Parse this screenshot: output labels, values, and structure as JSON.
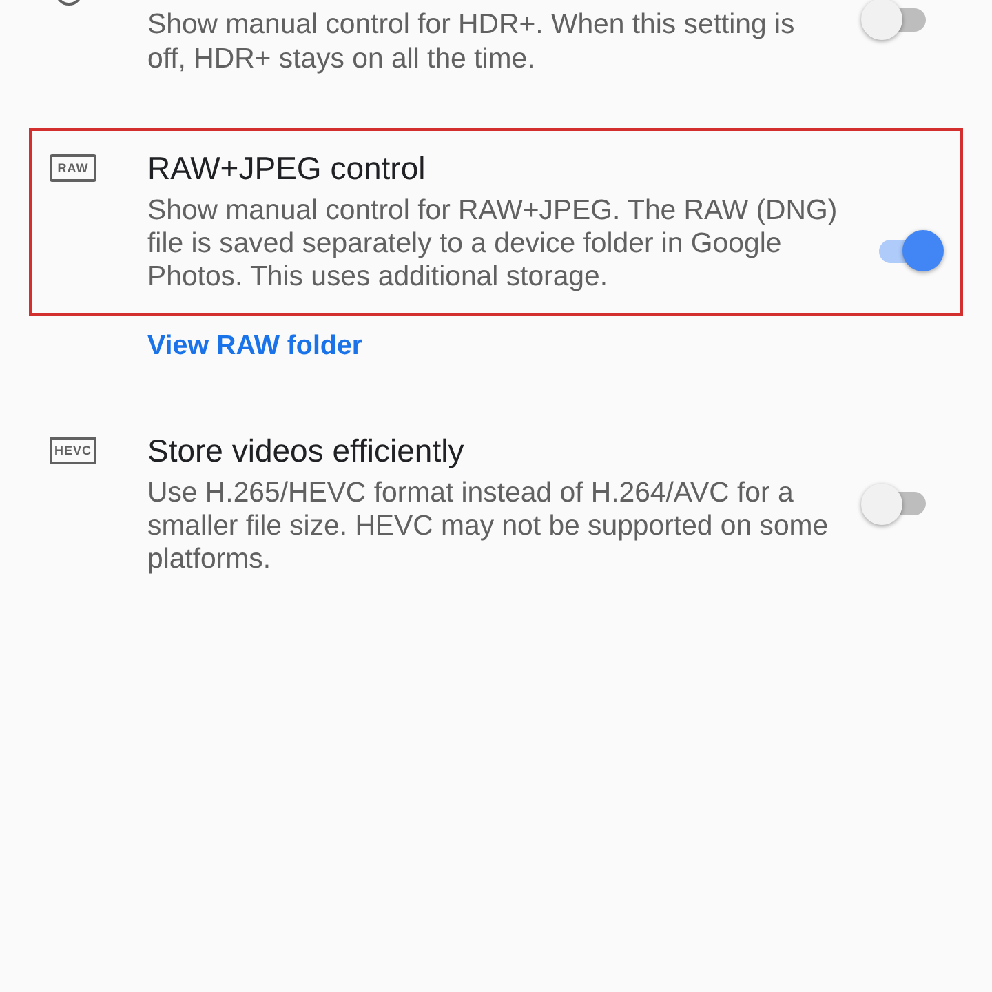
{
  "settings": [
    {
      "icon": {
        "kind": "circle"
      },
      "description": "Show manual control for HDR+. When this setting is off, HDR+ stays on all the time.",
      "on": false,
      "highlighted": false
    },
    {
      "icon": {
        "kind": "badge",
        "label": "RAW"
      },
      "title": "RAW+JPEG control",
      "description": "Show manual control for RAW+JPEG. The RAW (DNG) file is saved separately to a device folder in Google Photos. This uses additional storage.",
      "on": true,
      "highlighted": true,
      "link": "View RAW folder"
    },
    {
      "icon": {
        "kind": "badge",
        "label": "HEVC"
      },
      "title": "Store videos efficiently",
      "description": "Use H.265/HEVC format instead of H.264/AVC for a smaller file size. HEVC may not be supported on some platforms.",
      "on": false,
      "highlighted": false
    }
  ]
}
